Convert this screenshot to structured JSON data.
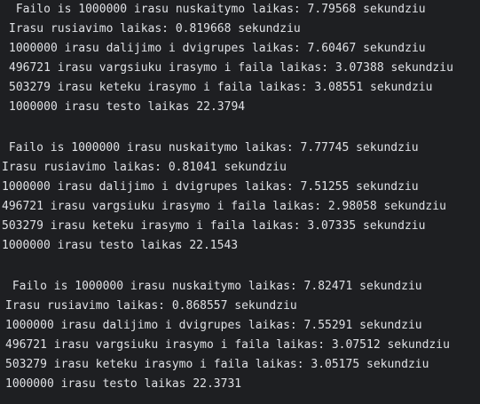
{
  "console": {
    "blocks": [
      {
        "lines": [
          " Failo is 1000000 irasu nuskaitymo laikas: 7.79568 sekundziu",
          "Irasu rusiavimo laikas: 0.819668 sekundziu",
          "1000000 irasu dalijimo i dvigrupes laikas: 7.60467 sekundziu",
          "496721 irasu vargsiuku irasymo i faila laikas: 3.07388 sekundziu",
          "503279 irasu keteku irasymo i faila laikas: 3.08551 sekundziu",
          "1000000 irasu testo laikas 22.3794"
        ]
      },
      {
        "lines": [
          " Failo is 1000000 irasu nuskaitymo laikas: 7.77745 sekundziu",
          "Irasu rusiavimo laikas: 0.81041 sekundziu",
          "1000000 irasu dalijimo i dvigrupes laikas: 7.51255 sekundziu",
          "496721 irasu vargsiuku irasymo i faila laikas: 2.98058 sekundziu",
          "503279 irasu keteku irasymo i faila laikas: 3.07335 sekundziu",
          "1000000 irasu testo laikas 22.1543"
        ]
      },
      {
        "lines": [
          " Failo is 1000000 irasu nuskaitymo laikas: 7.82471 sekundziu",
          "Irasu rusiavimo laikas: 0.868557 sekundziu",
          "1000000 irasu dalijimo i dvigrupes laikas: 7.55291 sekundziu",
          "496721 irasu vargsiuku irasymo i faila laikas: 3.07512 sekundziu",
          "503279 irasu keteku irasymo i faila laikas: 3.05175 sekundziu",
          "1000000 irasu testo laikas 22.3731"
        ]
      }
    ]
  }
}
